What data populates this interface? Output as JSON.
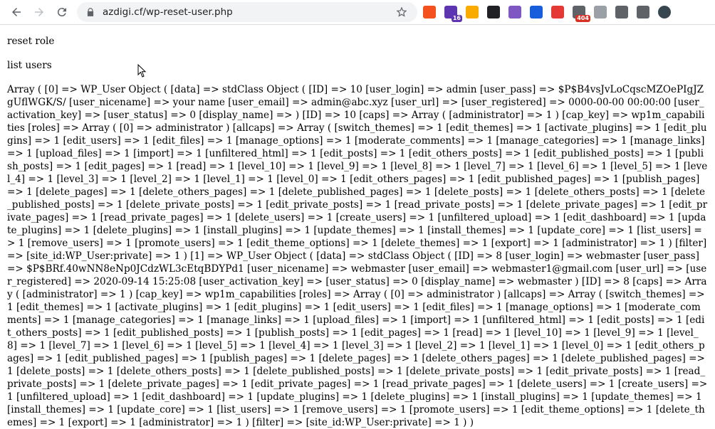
{
  "browser": {
    "url": "azdigi.cf/wp-reset-user.php",
    "extensions": [
      {
        "name": "extension-orange-icon",
        "color": "#f4511e",
        "badge": ""
      },
      {
        "name": "graduation-cap-icon",
        "color": "#5e35b1",
        "badge": "16",
        "badge_color": "#5e35b1"
      },
      {
        "name": "lock-extension-icon",
        "color": "#f9ab00",
        "badge": ""
      },
      {
        "name": "id-extension-icon",
        "color": "#202124",
        "badge": ""
      },
      {
        "name": "feather-icon",
        "color": "#7e57c2",
        "badge": ""
      },
      {
        "name": "bitwarden-icon",
        "color": "#175ddc",
        "badge": ""
      },
      {
        "name": "alert-triangle-icon",
        "color": "#e53935",
        "badge": ""
      },
      {
        "name": "headphones-icon",
        "color": "#5f6368",
        "badge": "404",
        "badge_color": "#d93025"
      },
      {
        "name": "cloud-icon",
        "color": "#9aa0a6",
        "badge": ""
      },
      {
        "name": "qr-code-icon",
        "color": "#5f6368",
        "badge": ""
      },
      {
        "name": "puzzle-icon",
        "color": "#5f6368",
        "badge": ""
      },
      {
        "name": "profile-avatar-icon",
        "color": "#37474f",
        "badge": ""
      }
    ]
  },
  "page": {
    "heading_reset": "reset role",
    "heading_list": "list users",
    "dump": "Array ( [0] => WP_User Object ( [data] => stdClass Object ( [ID] => 10 [user_login] => admin [user_pass] => $P$B4vsJvLoCqscMZOePIgJZgUflWGK/S/ [user_nicename] => your name [user_email] => admin@abc.xyz [user_url] => [user_registered] => 0000-00-00 00:00:00 [user_activation_key] => [user_status] => 0 [display_name] => ) [ID] => 10 [caps] => Array ( [administrator] => 1 ) [cap_key] => wp1m_capabilities [roles] => Array ( [0] => administrator ) [allcaps] => Array ( [switch_themes] => 1 [edit_themes] => 1 [activate_plugins] => 1 [edit_plugins] => 1 [edit_users] => 1 [edit_files] => 1 [manage_options] => 1 [moderate_comments] => 1 [manage_categories] => 1 [manage_links] => 1 [upload_files] => 1 [import] => 1 [unfiltered_html] => 1 [edit_posts] => 1 [edit_others_posts] => 1 [edit_published_posts] => 1 [publish_posts] => 1 [edit_pages] => 1 [read] => 1 [level_10] => 1 [level_9] => 1 [level_8] => 1 [level_7] => 1 [level_6] => 1 [level_5] => 1 [level_4] => 1 [level_3] => 1 [level_2] => 1 [level_1] => 1 [level_0] => 1 [edit_others_pages] => 1 [edit_published_pages] => 1 [publish_pages] => 1 [delete_pages] => 1 [delete_others_pages] => 1 [delete_published_pages] => 1 [delete_posts] => 1 [delete_others_posts] => 1 [delete_published_posts] => 1 [delete_private_posts] => 1 [edit_private_posts] => 1 [read_private_posts] => 1 [delete_private_pages] => 1 [edit_private_pages] => 1 [read_private_pages] => 1 [delete_users] => 1 [create_users] => 1 [unfiltered_upload] => 1 [edit_dashboard] => 1 [update_plugins] => 1 [delete_plugins] => 1 [install_plugins] => 1 [update_themes] => 1 [install_themes] => 1 [update_core] => 1 [list_users] => 1 [remove_users] => 1 [promote_users] => 1 [edit_theme_options] => 1 [delete_themes] => 1 [export] => 1 [administrator] => 1 ) [filter] => [site_id:WP_User:private] => 1 ) [1] => WP_User Object ( [data] => stdClass Object ( [ID] => 8 [user_login] => webmaster [user_pass] => $P$BRf.40wNN8eNp0JCdzWL3cEtqBDYPd1 [user_nicename] => webmaster [user_email] => webmaster1@gmail.com [user_url] => [user_registered] => 2020-09-14 15:25:08 [user_activation_key] => [user_status] => 0 [display_name] => webmaster ) [ID] => 8 [caps] => Array ( [administrator] => 1 ) [cap_key] => wp1m_capabilities [roles] => Array ( [0] => administrator ) [allcaps] => Array ( [switch_themes] => 1 [edit_themes] => 1 [activate_plugins] => 1 [edit_plugins] => 1 [edit_users] => 1 [edit_files] => 1 [manage_options] => 1 [moderate_comments] => 1 [manage_categories] => 1 [manage_links] => 1 [upload_files] => 1 [import] => 1 [unfiltered_html] => 1 [edit_posts] => 1 [edit_others_posts] => 1 [edit_published_posts] => 1 [publish_posts] => 1 [edit_pages] => 1 [read] => 1 [level_10] => 1 [level_9] => 1 [level_8] => 1 [level_7] => 1 [level_6] => 1 [level_5] => 1 [level_4] => 1 [level_3] => 1 [level_2] => 1 [level_1] => 1 [level_0] => 1 [edit_others_pages] => 1 [edit_published_pages] => 1 [publish_pages] => 1 [delete_pages] => 1 [delete_others_pages] => 1 [delete_published_pages] => 1 [delete_posts] => 1 [delete_others_posts] => 1 [delete_published_posts] => 1 [delete_private_posts] => 1 [edit_private_posts] => 1 [read_private_posts] => 1 [delete_private_pages] => 1 [edit_private_pages] => 1 [read_private_pages] => 1 [delete_users] => 1 [create_users] => 1 [unfiltered_upload] => 1 [edit_dashboard] => 1 [update_plugins] => 1 [delete_plugins] => 1 [install_plugins] => 1 [update_themes] => 1 [install_themes] => 1 [update_core] => 1 [list_users] => 1 [remove_users] => 1 [promote_users] => 1 [edit_theme_options] => 1 [delete_themes] => 1 [export] => 1 [administrator] => 1 ) [filter] => [site_id:WP_User:private] => 1 ) )"
  }
}
